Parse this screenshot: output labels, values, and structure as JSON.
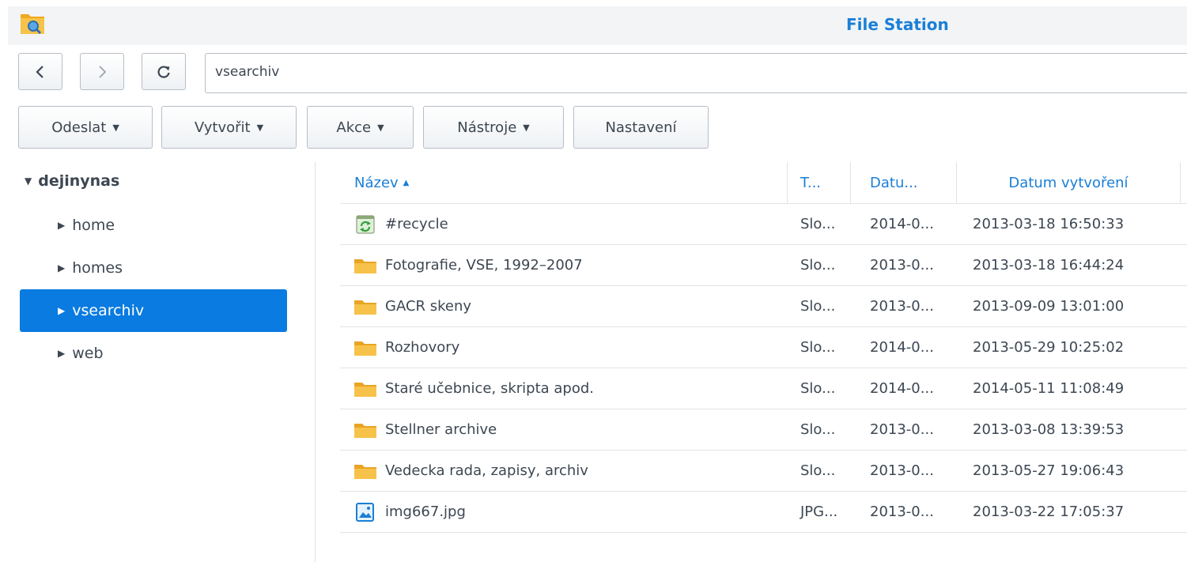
{
  "window": {
    "title": "File Station",
    "app_icon": "file-station-icon"
  },
  "nav": {
    "back_icon": "chevron-left-icon",
    "forward_icon": "chevron-right-icon",
    "refresh_icon": "refresh-icon",
    "path_value": "vsearchiv"
  },
  "toolbar": {
    "upload_label": "Odeslat",
    "create_label": "Vytvořit",
    "action_label": "Akce",
    "tools_label": "Nástroje",
    "settings_label": "Nastavení"
  },
  "sidebar": {
    "root": "dejinynas",
    "items": [
      {
        "label": "home"
      },
      {
        "label": "homes"
      },
      {
        "label": "vsearchiv",
        "selected": true
      },
      {
        "label": "web"
      }
    ]
  },
  "table": {
    "columns": {
      "name": "Název",
      "type": "T...",
      "modified": "Datu...",
      "created": "Datum vytvoření"
    },
    "sort": {
      "column": "name",
      "direction": "asc"
    },
    "rows": [
      {
        "icon": "recycle-bin-icon",
        "name": "#recycle",
        "type": "Slo...",
        "modified": "2014-0...",
        "created": "2013-03-18 16:50:33"
      },
      {
        "icon": "folder-icon",
        "name": "Fotografie, VSE, 1992–2007",
        "type": "Slo...",
        "modified": "2013-0...",
        "created": "2013-03-18 16:44:24"
      },
      {
        "icon": "folder-icon",
        "name": "GACR skeny",
        "type": "Slo...",
        "modified": "2013-0...",
        "created": "2013-09-09 13:01:00"
      },
      {
        "icon": "folder-icon",
        "name": "Rozhovory",
        "type": "Slo...",
        "modified": "2014-0...",
        "created": "2013-05-29 10:25:02"
      },
      {
        "icon": "folder-icon",
        "name": "Staré učebnice, skripta apod.",
        "type": "Slo...",
        "modified": "2014-0...",
        "created": "2014-05-11 11:08:49"
      },
      {
        "icon": "folder-icon",
        "name": "Stellner archive",
        "type": "Slo...",
        "modified": "2013-0...",
        "created": "2013-03-08 13:39:53"
      },
      {
        "icon": "folder-icon",
        "name": "Vedecka rada, zapisy, archiv",
        "type": "Slo...",
        "modified": "2013-0...",
        "created": "2013-05-27 19:06:43"
      },
      {
        "icon": "image-file-icon",
        "name": "img667.jpg",
        "type": "JPG...",
        "modified": "2013-0...",
        "created": "2013-03-22 17:05:37"
      }
    ]
  },
  "colors": {
    "accent": "#1a7fd6",
    "selection": "#0a7be0",
    "folder": "#f5b82e"
  }
}
